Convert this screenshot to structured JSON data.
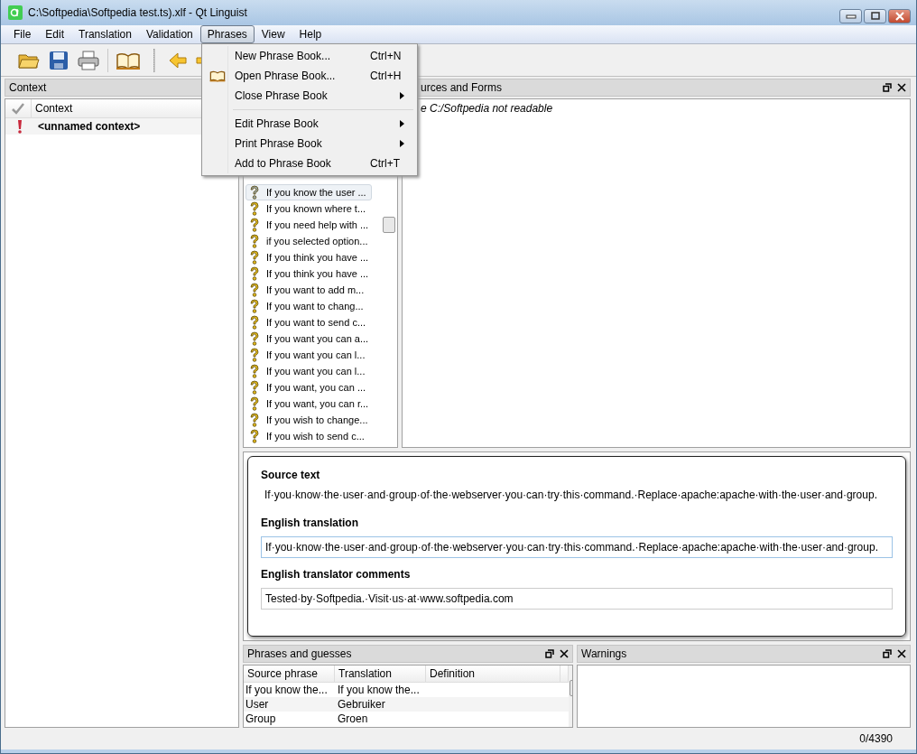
{
  "window": {
    "title": "C:\\Softpedia\\Softpedia test.ts).xlf - Qt Linguist"
  },
  "menu_bar": [
    {
      "label": "File",
      "selected": false
    },
    {
      "label": "Edit",
      "selected": false
    },
    {
      "label": "Translation",
      "selected": false
    },
    {
      "label": "Validation",
      "selected": false
    },
    {
      "label": "Phrases",
      "selected": true
    },
    {
      "label": "View",
      "selected": false
    },
    {
      "label": "Help",
      "selected": false
    }
  ],
  "phrases_menu": [
    {
      "kind": "item",
      "label": "New Phrase Book...",
      "shortcut": "Ctrl+N",
      "submenu": false,
      "icon": false
    },
    {
      "kind": "item",
      "label": "Open Phrase Book...",
      "shortcut": "Ctrl+H",
      "submenu": false,
      "icon": true
    },
    {
      "kind": "item",
      "label": "Close Phrase Book",
      "submenu": true,
      "icon": false
    },
    {
      "kind": "separator"
    },
    {
      "kind": "item",
      "label": "Edit Phrase Book",
      "submenu": true,
      "icon": false
    },
    {
      "kind": "item",
      "label": "Print Phrase Book",
      "submenu": true,
      "icon": false
    },
    {
      "kind": "item",
      "label": "Add to Phrase Book",
      "shortcut": "Ctrl+T",
      "submenu": false,
      "icon": false
    }
  ],
  "context_dock": {
    "title": "Context",
    "columns": [
      "Context"
    ],
    "rows": [
      {
        "name": "<unnamed context>"
      }
    ]
  },
  "strings": [
    {
      "text": "If you know the user ...",
      "selected": true
    },
    {
      "text": "If you known where t...",
      "selected": false
    },
    {
      "text": "If you need help with ...",
      "selected": false
    },
    {
      "text": "if you selected option...",
      "selected": false
    },
    {
      "text": "If you think you have ...",
      "selected": false
    },
    {
      "text": "If you think you have ...",
      "selected": false
    },
    {
      "text": "If you want to add m...",
      "selected": false
    },
    {
      "text": "If you want to chang...",
      "selected": false
    },
    {
      "text": "If you want to send c...",
      "selected": false
    },
    {
      "text": "If you want you can a...",
      "selected": false
    },
    {
      "text": "If you want you can l...",
      "selected": false
    },
    {
      "text": "If you want you can l...",
      "selected": false
    },
    {
      "text": "If you want, you can ...",
      "selected": false
    },
    {
      "text": "If you want, you can r...",
      "selected": false
    },
    {
      "text": "If you wish to change...",
      "selected": false
    },
    {
      "text": "If you wish to send c...",
      "selected": false
    }
  ],
  "sources_dock": {
    "title": "urces and Forms",
    "message": "e C:/Softpedia not readable"
  },
  "editor": {
    "source_label": "Source text",
    "source_text": "If·you·know·the·user·and·group·of·the·webserver·you·can·try·this·command.·Replace·apache:apache·with·the·user·and·group.",
    "translation_label": "English translation",
    "translation": "If·you·know·the·user·and·group·of·the·webserver·you·can·try·this·command.·Replace·apache:apache·with·the·user·and·group.",
    "comments_label": "English translator comments",
    "comments": "Tested·by·Softpedia.·Visit·us·at·www.softpedia.com"
  },
  "phrases_dock": {
    "title": "Phrases and guesses",
    "columns": [
      "Source phrase",
      "Translation",
      "Definition"
    ],
    "rows": [
      [
        "If you know the...",
        "If you know the..."
      ],
      [
        "User",
        "Gebruiker"
      ],
      [
        "Group",
        "Groen"
      ]
    ]
  },
  "warnings_dock": {
    "title": "Warnings"
  },
  "status_bar": {
    "count": "0/4390"
  }
}
